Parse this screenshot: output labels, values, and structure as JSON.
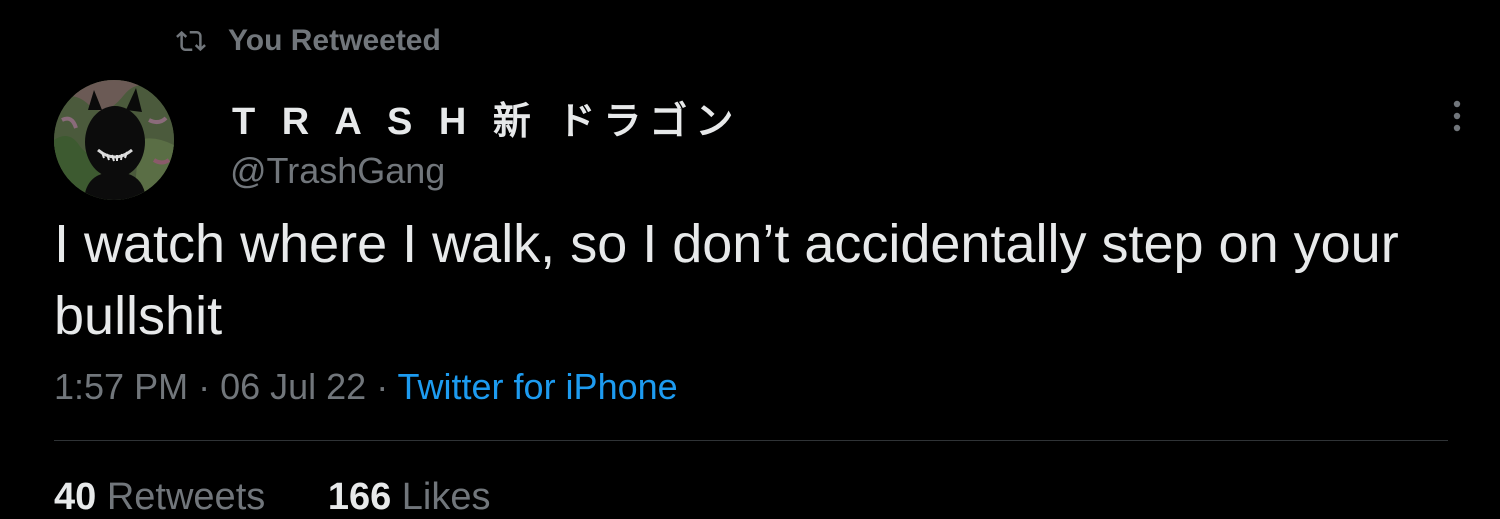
{
  "retweet_context": {
    "label": "You Retweeted",
    "icon": "retweet-icon"
  },
  "author": {
    "display_name": "T R A S H  新 ドラゴン",
    "handle": "@TrashGang",
    "avatar_icon": "avatar"
  },
  "more_icon": "more-vertical-icon",
  "tweet": {
    "text": "I watch where I walk, so I don’t accidentally step on your bullshit"
  },
  "meta": {
    "time": "1:57 PM",
    "separator1": " · ",
    "date": "06 Jul 22",
    "separator2": " · ",
    "source": "Twitter for iPhone"
  },
  "stats": {
    "retweets_count": "40",
    "retweets_label": "Retweets",
    "likes_count": "166",
    "likes_label": "Likes"
  },
  "colors": {
    "background": "#000000",
    "primary_text": "#e7e9ea",
    "secondary_text": "#71767b",
    "link": "#1d9bf0",
    "divider": "#2f3336"
  }
}
